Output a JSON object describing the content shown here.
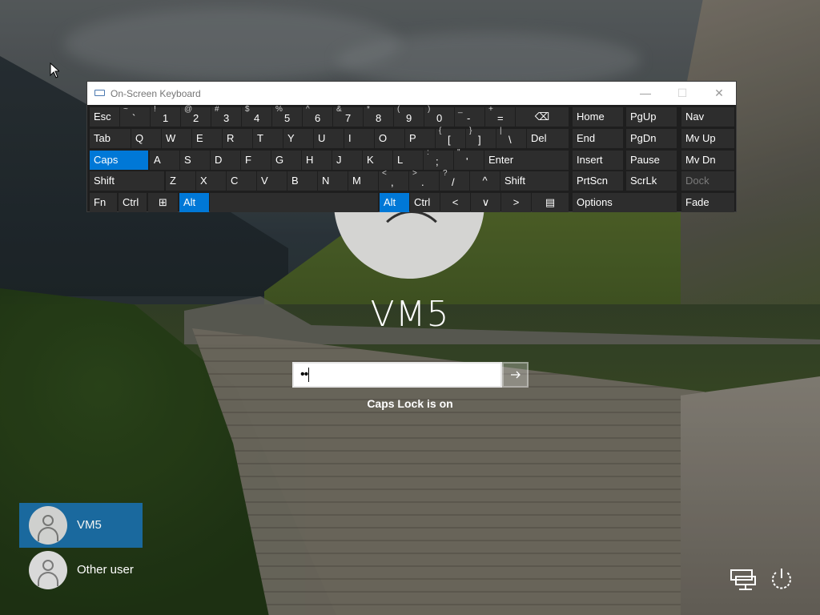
{
  "osk": {
    "title": "On-Screen Keyboard",
    "window_buttons": {
      "minimize": "—",
      "maximize": "☐",
      "close": "✕"
    },
    "rows": [
      [
        {
          "main": "Esc"
        },
        {
          "shift": "~",
          "main": "`"
        },
        {
          "shift": "!",
          "main": "1"
        },
        {
          "shift": "@",
          "main": "2"
        },
        {
          "shift": "#",
          "main": "3"
        },
        {
          "shift": "$",
          "main": "4"
        },
        {
          "shift": "%",
          "main": "5"
        },
        {
          "shift": "^",
          "main": "6"
        },
        {
          "shift": "&",
          "main": "7"
        },
        {
          "shift": "*",
          "main": "8"
        },
        {
          "shift": "(",
          "main": "9"
        },
        {
          "shift": ")",
          "main": "0"
        },
        {
          "shift": "_",
          "main": "-"
        },
        {
          "shift": "+",
          "main": "="
        },
        {
          "main": "⌫"
        },
        {
          "main": "Home"
        },
        {
          "main": "PgUp"
        },
        {
          "main": "Nav"
        }
      ],
      [
        {
          "main": "Tab"
        },
        {
          "main": "Q"
        },
        {
          "main": "W"
        },
        {
          "main": "E"
        },
        {
          "main": "R"
        },
        {
          "main": "T"
        },
        {
          "main": "Y"
        },
        {
          "main": "U"
        },
        {
          "main": "I"
        },
        {
          "main": "O"
        },
        {
          "main": "P"
        },
        {
          "shift": "{",
          "main": "["
        },
        {
          "shift": "}",
          "main": "]"
        },
        {
          "shift": "|",
          "main": "\\"
        },
        {
          "main": "Del"
        },
        {
          "main": "End"
        },
        {
          "main": "PgDn"
        },
        {
          "main": "Mv Up"
        }
      ],
      [
        {
          "main": "Caps"
        },
        {
          "main": "A"
        },
        {
          "main": "S"
        },
        {
          "main": "D"
        },
        {
          "main": "F"
        },
        {
          "main": "G"
        },
        {
          "main": "H"
        },
        {
          "main": "J"
        },
        {
          "main": "K"
        },
        {
          "main": "L"
        },
        {
          "shift": ":",
          "main": ";"
        },
        {
          "shift": "\"",
          "main": "'"
        },
        {
          "main": "Enter"
        },
        {
          "main": "Insert"
        },
        {
          "main": "Pause"
        },
        {
          "main": "Mv Dn"
        }
      ],
      [
        {
          "main": "Shift"
        },
        {
          "main": "Z"
        },
        {
          "main": "X"
        },
        {
          "main": "C"
        },
        {
          "main": "V"
        },
        {
          "main": "B"
        },
        {
          "main": "N"
        },
        {
          "main": "M"
        },
        {
          "shift": "<",
          "main": ","
        },
        {
          "shift": ">",
          "main": "."
        },
        {
          "shift": "?",
          "main": "/"
        },
        {
          "main": "^"
        },
        {
          "main": "Shift"
        },
        {
          "main": "PrtScn"
        },
        {
          "main": "ScrLk"
        },
        {
          "main": "Dock"
        }
      ],
      [
        {
          "main": "Fn"
        },
        {
          "main": "Ctrl"
        },
        {
          "main": "⊞"
        },
        {
          "main": "Alt"
        },
        {
          "main": ""
        },
        {
          "main": "Alt"
        },
        {
          "main": "Ctrl"
        },
        {
          "main": "<"
        },
        {
          "main": "∨"
        },
        {
          "main": ">"
        },
        {
          "main": "▤"
        },
        {
          "main": "Options"
        },
        {
          "main": "Fade"
        }
      ]
    ],
    "active_color": "#0078d7"
  },
  "login": {
    "username": "VM5",
    "password_mask": "••",
    "submit_icon": "arrow-right-icon",
    "caps_warning": "Caps Lock is on"
  },
  "users": [
    {
      "name": "VM5",
      "selected": true
    },
    {
      "name": "Other user",
      "selected": false
    }
  ],
  "system_icons": [
    "network-icon",
    "power-icon"
  ]
}
